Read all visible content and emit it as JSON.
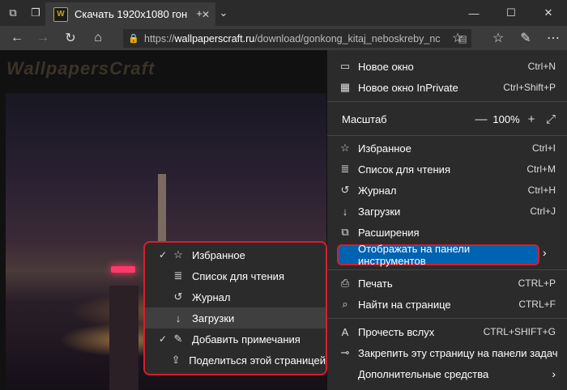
{
  "tab": {
    "title": "Скачать 1920x1080 гон",
    "favicon": "W",
    "close": "✕"
  },
  "window": {
    "minimize": "—",
    "maximize": "☐",
    "close": "✕"
  },
  "address": {
    "prefix": "https://",
    "domain": "wallpaperscraft.ru",
    "path": "/download/gonkong_kitaj_neboskreby_nc"
  },
  "page": {
    "logo": "WallpapersCraft"
  },
  "menu": {
    "new_window": {
      "label": "Новое окно",
      "shortcut": "Ctrl+N"
    },
    "inprivate": {
      "label": "Новое окно InPrivate",
      "shortcut": "Ctrl+Shift+P"
    },
    "zoom": {
      "label": "Масштаб",
      "minus": "—",
      "value": "100%",
      "plus": "+",
      "fullscreen": "⤢"
    },
    "favorites": {
      "label": "Избранное",
      "shortcut": "Ctrl+I"
    },
    "reading_list": {
      "label": "Список для чтения",
      "shortcut": "Ctrl+M"
    },
    "history": {
      "label": "Журнал",
      "shortcut": "Ctrl+H"
    },
    "downloads": {
      "label": "Загрузки",
      "shortcut": "Ctrl+J"
    },
    "extensions": {
      "label": "Расширения"
    },
    "show_in_toolbar": {
      "label": "Отображать на панели инструментов",
      "arrow": "›"
    },
    "print": {
      "label": "Печать",
      "shortcut": "CTRL+P"
    },
    "find": {
      "label": "Найти на странице",
      "shortcut": "CTRL+F"
    },
    "read_aloud": {
      "label": "Прочесть вслух",
      "shortcut": "CTRL+SHIFT+G"
    },
    "pin_taskbar": {
      "label": "Закрепить эту страницу на панели задач"
    },
    "more_tools": {
      "label": "Дополнительные средства",
      "arrow": "›"
    }
  },
  "submenu": {
    "items": [
      {
        "label": "Избранное",
        "checked": true
      },
      {
        "label": "Список для чтения",
        "checked": false
      },
      {
        "label": "Журнал",
        "checked": false
      },
      {
        "label": "Загрузки",
        "checked": false
      },
      {
        "label": "Добавить примечания",
        "checked": true
      },
      {
        "label": "Поделиться этой страницей",
        "checked": false
      }
    ],
    "check": "✓"
  },
  "colors": {
    "accent": "#0063b1",
    "highlight_border": "#d81e2c",
    "menu_bg": "#2b2b2b"
  }
}
